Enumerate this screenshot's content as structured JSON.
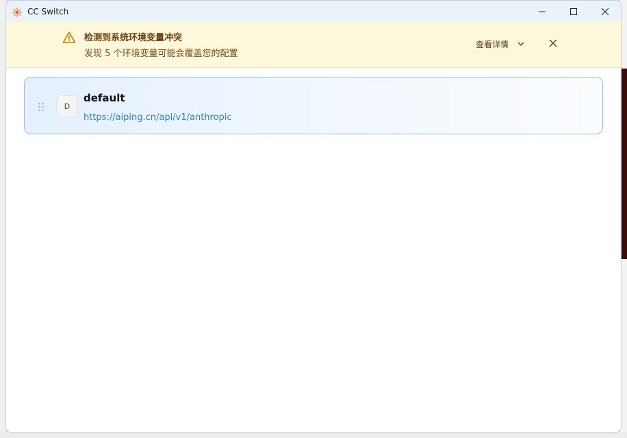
{
  "window": {
    "title": "CC Switch"
  },
  "banner": {
    "title": "检测到系统环境变量冲突",
    "subtitle": "发现 5 个环境变量可能会覆盖您的配置",
    "details_label": "查看详情"
  },
  "providers": [
    {
      "avatar_letter": "D",
      "name": "default",
      "url": "https://aiping.cn/api/v1/anthropic"
    }
  ],
  "colors": {
    "banner_bg": "#fdf8dc",
    "banner_text": "#6b3d0c",
    "accent_link": "#2f7fd1",
    "card_border": "#8cc0ec",
    "warning_icon": "#c98a0c"
  }
}
